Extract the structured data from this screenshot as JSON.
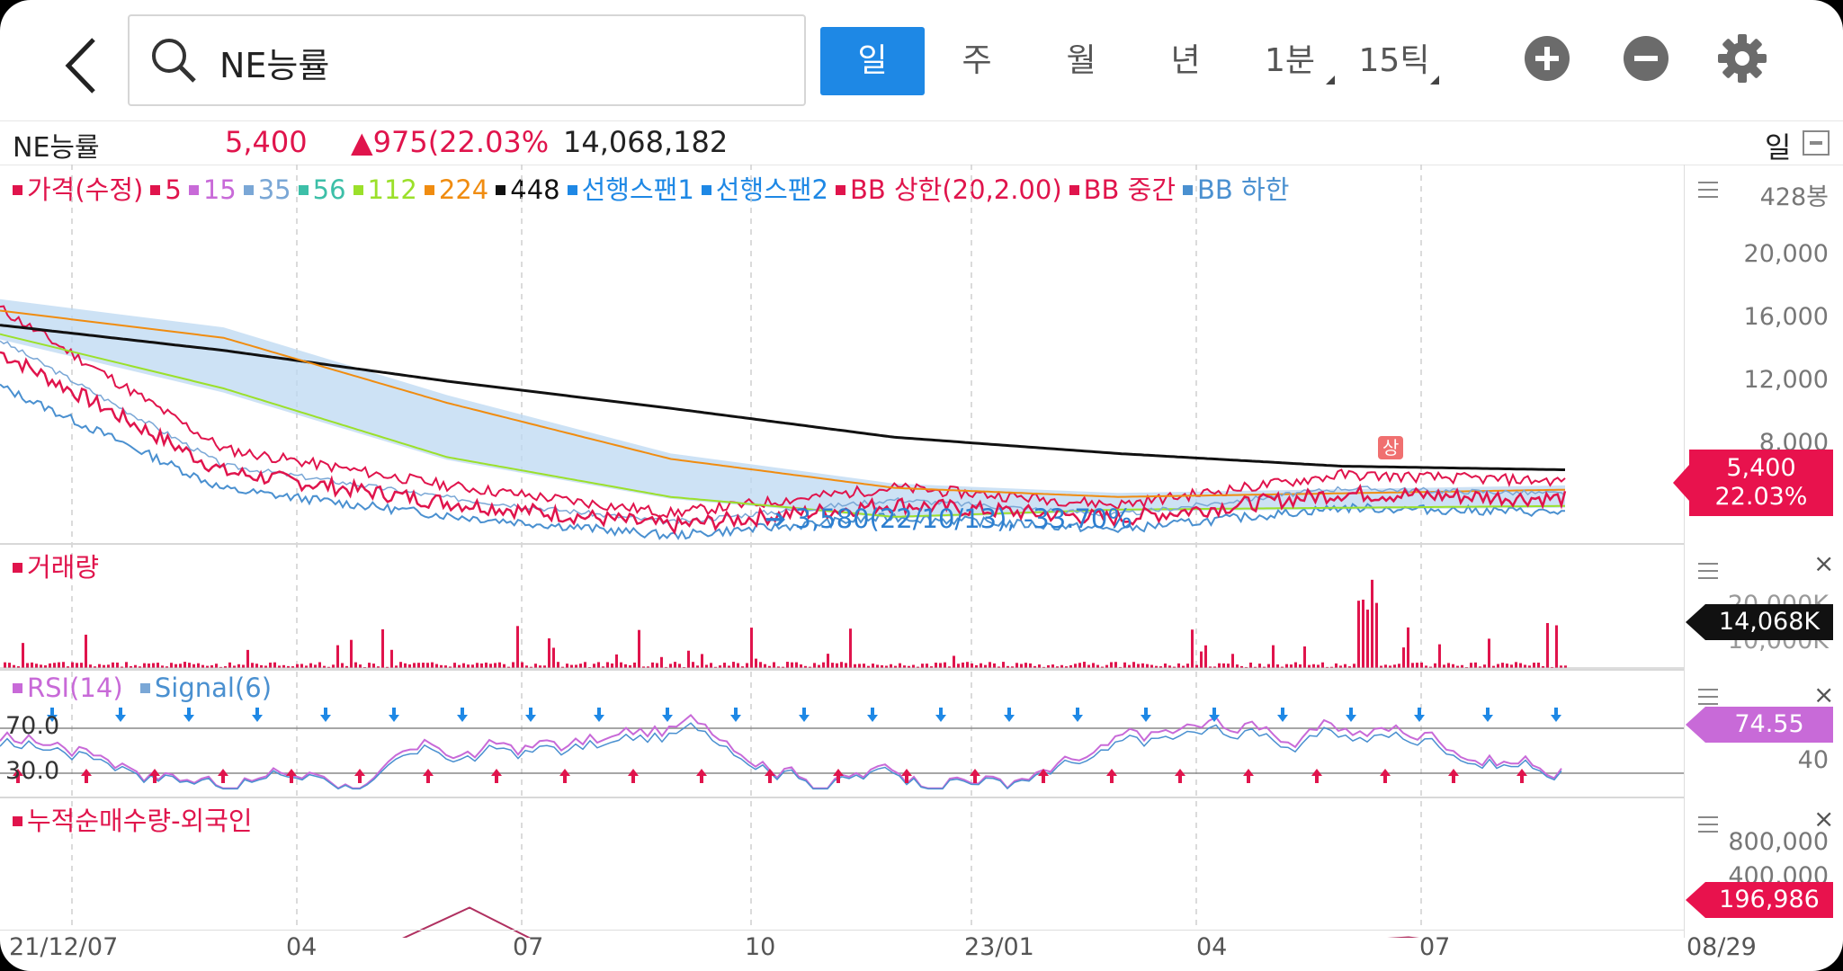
{
  "header": {
    "search_value": "NE능률",
    "periods": [
      "일",
      "주",
      "월",
      "년",
      "1분",
      "15틱"
    ],
    "active_period": "일"
  },
  "stock": {
    "name": "NE능률",
    "price": "5,400",
    "change": "▲975(22.03%",
    "volume": "14,068,182",
    "period_label": "일"
  },
  "price_legend": [
    {
      "label": "가격(수정)",
      "color": "#e0144c"
    },
    {
      "label": "5",
      "color": "#e0144c"
    },
    {
      "label": "15",
      "color": "#c86ad8"
    },
    {
      "label": "35",
      "color": "#7aa7d6"
    },
    {
      "label": "56",
      "color": "#3dbfa8"
    },
    {
      "label": "112",
      "color": "#9be02a"
    },
    {
      "label": "224",
      "color": "#f08c10"
    },
    {
      "label": "448",
      "color": "#111111"
    },
    {
      "label": "선행스팬1",
      "color": "#1e88e5"
    },
    {
      "label": "선행스팬2",
      "color": "#1e88e5"
    },
    {
      "label": "BB 상한(20,2.00)",
      "color": "#e0144c"
    },
    {
      "label": "BB 중간",
      "color": "#e0144c"
    },
    {
      "label": "BB 하한",
      "color": "#4a90d0"
    }
  ],
  "price_axis": [
    "428봉",
    "20,000",
    "16,000",
    "12,000",
    "8,000"
  ],
  "price_tag": {
    "price": "5,400",
    "pct": "22.03%"
  },
  "low_annotation": "➔ 3,580(22/10/13), -33.70%",
  "signal_marker": "상",
  "volume_legend": "거래량",
  "volume_axis": [
    "20,000K",
    "10,000K"
  ],
  "volume_tag": "14,068K",
  "rsi_legend": [
    {
      "label": "RSI(14)",
      "color": "#c86ad8"
    },
    {
      "label": "Signal(6)",
      "color": "#4a90d0"
    }
  ],
  "rsi_levels": [
    "70.0",
    "30.0"
  ],
  "rsi_axis": [
    "40"
  ],
  "rsi_tag": "74.55",
  "cum_legend": "누적순매수량-외국인",
  "cum_axis": [
    "800,000",
    "400,000"
  ],
  "cum_tag": "196,986",
  "x_labels": [
    "21/12/07",
    "04",
    "07",
    "10",
    "23/01",
    "04",
    "07",
    "08/29"
  ],
  "colors": {
    "up": "#e0144c",
    "down": "#1e88e5",
    "accent": "#1e88e5"
  },
  "chart_data": {
    "type": "line",
    "title": "",
    "x": [
      "21/12/07",
      "04",
      "07",
      "10",
      "23/01",
      "04",
      "07",
      "08/29"
    ],
    "series": [
      {
        "name": "가격(수정)",
        "values": [
          13500,
          6900,
          5200,
          3900,
          5100,
          4300,
          5700,
          5400
        ]
      },
      {
        "name": "448",
        "values": [
          15000,
          13600,
          11900,
          10400,
          8800,
          7900,
          7200,
          7000
        ]
      },
      {
        "name": "224",
        "values": [
          15800,
          14300,
          10700,
          7600,
          6000,
          5500,
          5700,
          5900
        ]
      },
      {
        "name": "112",
        "values": [
          14500,
          11500,
          7700,
          5500,
          4400,
          4800,
          4900,
          5000
        ]
      }
    ],
    "ylim": [
      3000,
      20000
    ],
    "low_point": {
      "value": 3580,
      "date": "22/10/13",
      "pct": -33.7
    },
    "last_price": 5400,
    "last_change_pct": 22.03,
    "volume_last": 14068182,
    "rsi_last": 74.55,
    "rsi_levels": [
      70.0,
      30.0
    ],
    "cumulative_net_buy_foreign_last": 196986
  }
}
